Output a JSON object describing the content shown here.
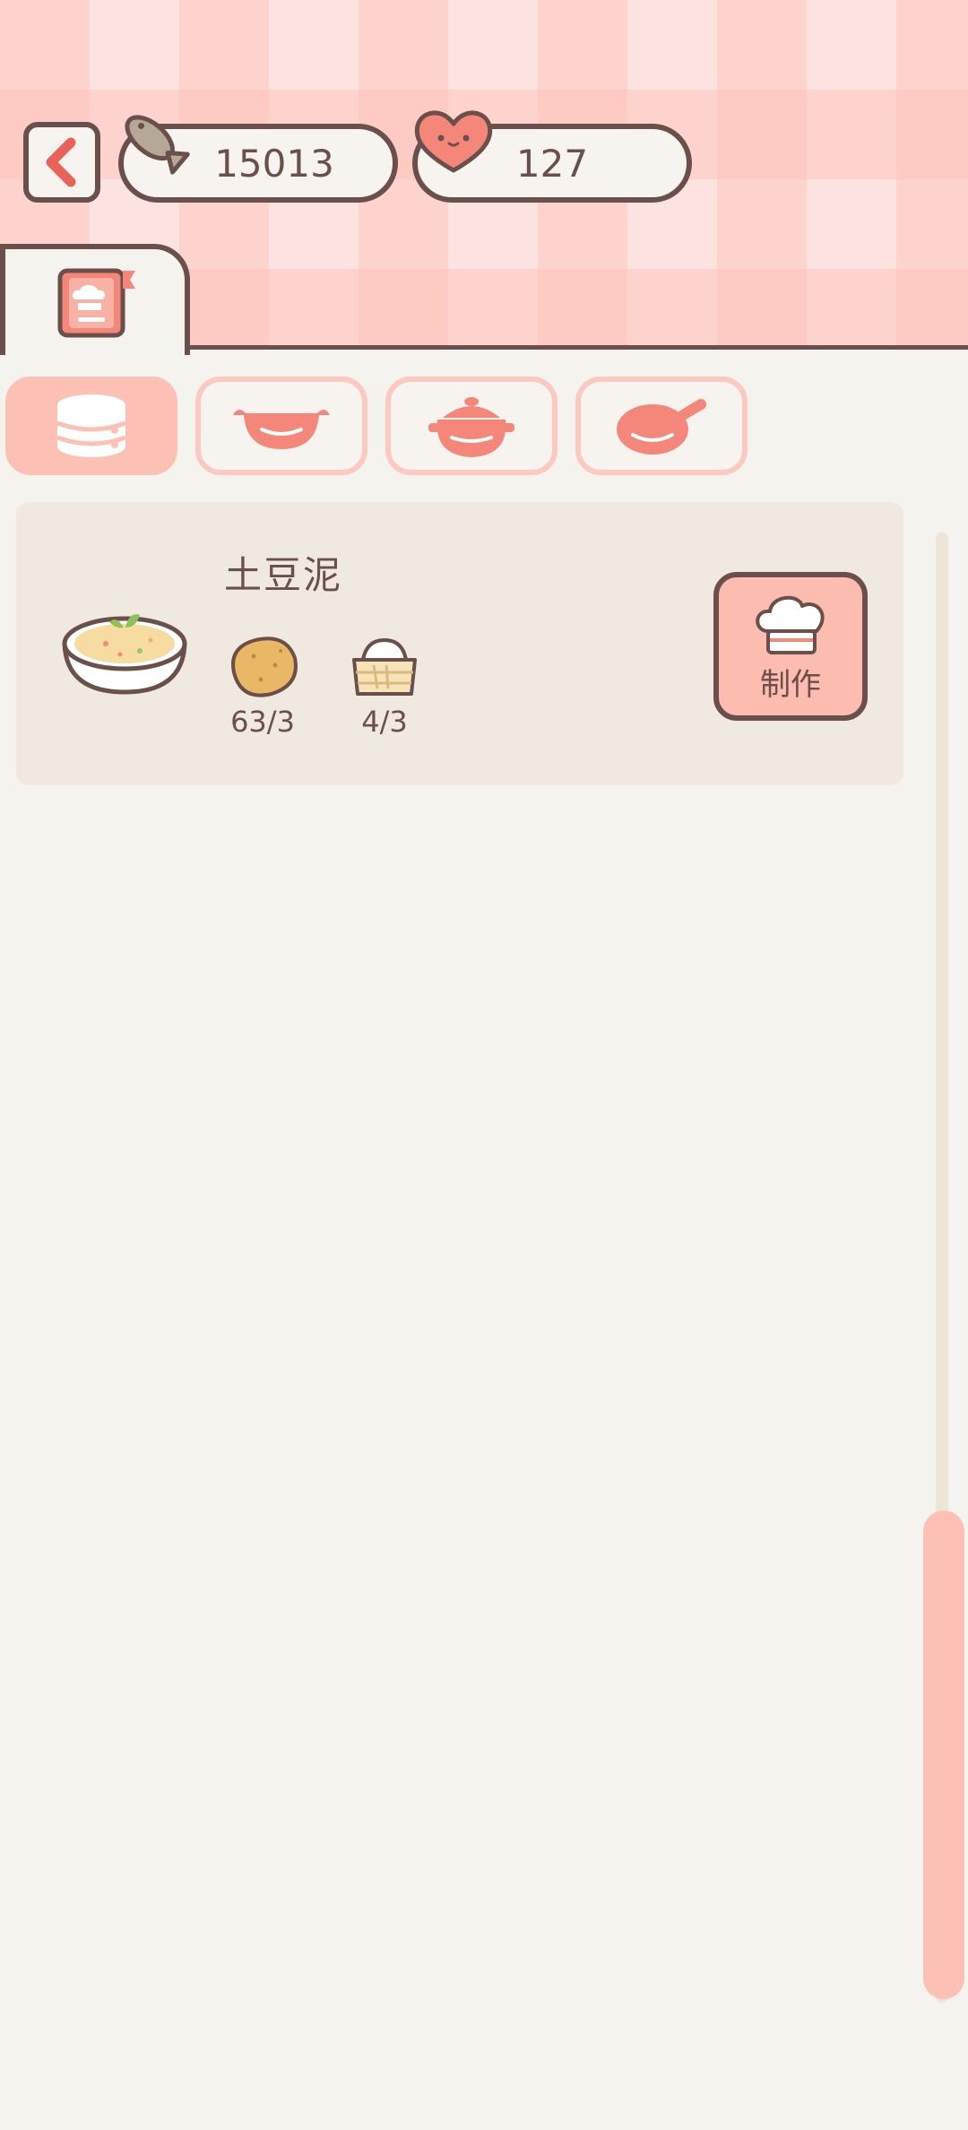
{
  "header": {
    "fish_count": "15013",
    "heart_count": "127"
  },
  "icons": {
    "back": "chevron-left-icon",
    "fish": "fish-icon",
    "heart": "heart-icon",
    "recipe_book": "recipe-book-icon",
    "category_1": "steamer-icon",
    "category_2": "wok-icon",
    "category_3": "pot-icon",
    "category_4": "frying-pan-icon",
    "make": "chef-hat-icon"
  },
  "categories": [
    {
      "icon": "steamer-icon",
      "active": true
    },
    {
      "icon": "wok-icon",
      "active": false
    },
    {
      "icon": "pot-icon",
      "active": false
    },
    {
      "icon": "frying-pan-icon",
      "active": false
    }
  ],
  "recipe": {
    "name": "土豆泥",
    "dish_icon": "mashed-potato-bowl-icon",
    "ingredients": [
      {
        "icon": "potato-icon",
        "count": "63/3"
      },
      {
        "icon": "flour-icon",
        "count": "4/3"
      }
    ],
    "make_label": "制作"
  },
  "colors": {
    "accent": "#fcc0b5",
    "outline": "#6b4f4a",
    "background": "#f5f3ee",
    "card": "#efe9df"
  }
}
